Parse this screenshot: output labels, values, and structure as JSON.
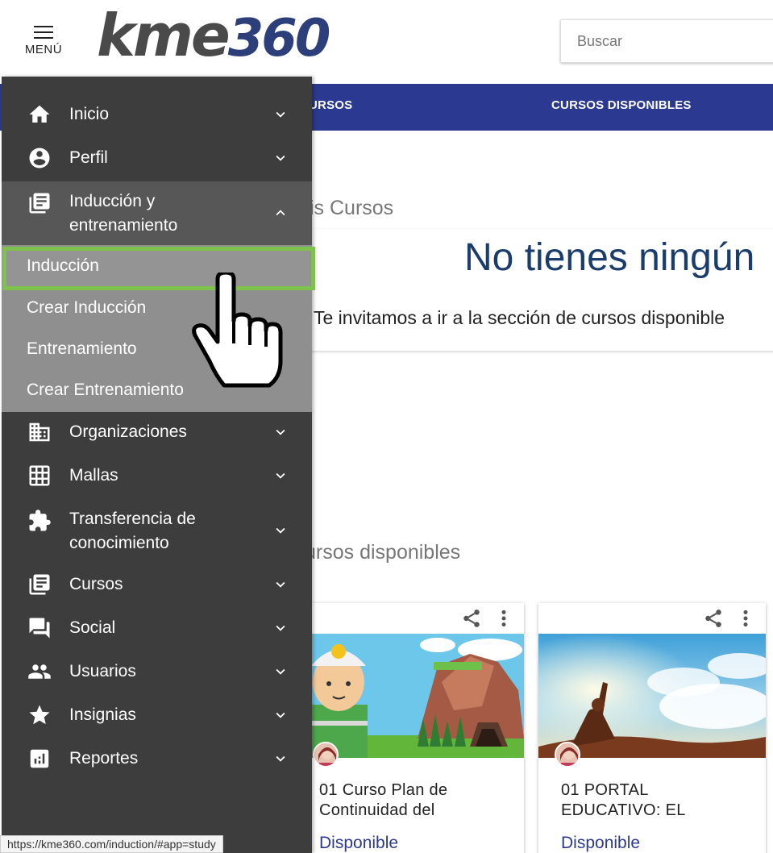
{
  "header": {
    "menu_label": "MENÚ",
    "logo_text_main": "kme",
    "logo_text_num": "360",
    "search_placeholder": "Buscar"
  },
  "navbar": {
    "tabs": [
      {
        "label": "URSOS"
      },
      {
        "label": "CURSOS DISPONIBLES"
      }
    ]
  },
  "main": {
    "my_courses_title": "is Cursos",
    "empty_heading": "No tienes ningún",
    "empty_subtitle": "Te invitamos a ir a la sección de cursos disponible",
    "available_title": "ursos disponibles",
    "courses": [
      {
        "title": "01 Curso Plan de Continuidad del",
        "status": "Disponible"
      },
      {
        "title": "01 PORTAL EDUCATIVO: EL",
        "status": "Disponible"
      }
    ]
  },
  "sidebar": {
    "items": [
      {
        "label": "Inicio",
        "icon": "home-icon"
      },
      {
        "label": "Perfil",
        "icon": "account-circle-icon"
      },
      {
        "label": "Inducción y entrenamiento",
        "icon": "library-books-icon"
      },
      {
        "label": "Organizaciones",
        "icon": "business-icon"
      },
      {
        "label": "Mallas",
        "icon": "grid-icon"
      },
      {
        "label": "Transferencia de conocimiento",
        "icon": "puzzle-icon"
      },
      {
        "label": "Cursos",
        "icon": "library-books-icon"
      },
      {
        "label": "Social",
        "icon": "forum-icon"
      },
      {
        "label": "Usuarios",
        "icon": "people-icon"
      },
      {
        "label": "Insignias",
        "icon": "star-icon"
      },
      {
        "label": "Reportes",
        "icon": "chart-icon"
      }
    ],
    "subitems": [
      {
        "label": "Inducción"
      },
      {
        "label": "Crear Inducción"
      },
      {
        "label": "Entrenamiento"
      },
      {
        "label": "Crear Entrenamiento"
      }
    ]
  },
  "status_bar": {
    "url": "https://kme360.com/induction/#app=study"
  },
  "colors": {
    "brand_blue": "#2b3990",
    "sidebar_bg": "#3d3d3d",
    "highlight_green": "#7dc24b",
    "heading_blue": "#1a3d6e"
  }
}
